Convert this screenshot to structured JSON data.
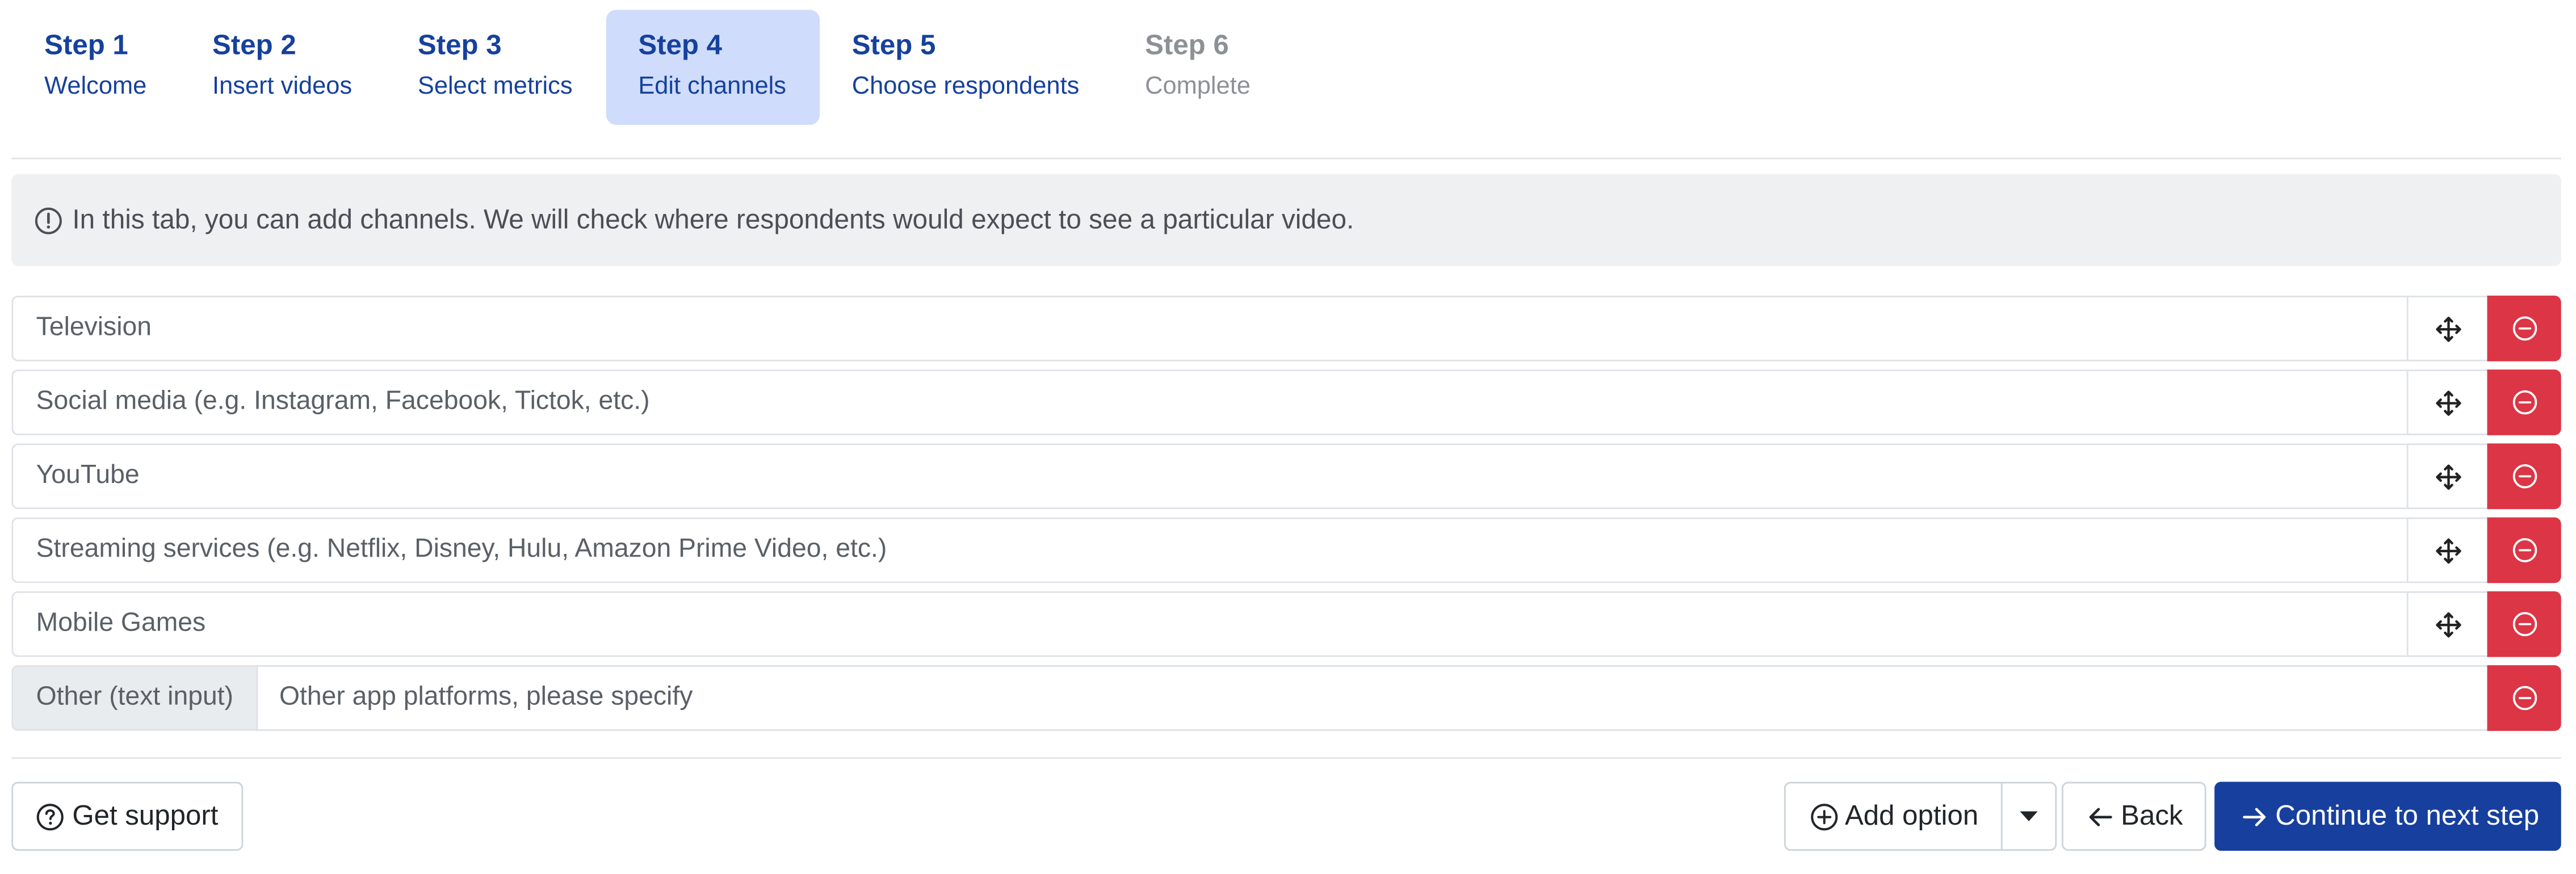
{
  "steps": [
    {
      "number": "Step 1",
      "label": "Welcome"
    },
    {
      "number": "Step 2",
      "label": "Insert videos"
    },
    {
      "number": "Step 3",
      "label": "Select metrics"
    },
    {
      "number": "Step 4",
      "label": "Edit channels"
    },
    {
      "number": "Step 5",
      "label": "Choose respondents"
    },
    {
      "number": "Step 6",
      "label": "Complete"
    }
  ],
  "active_step": "Step 4",
  "info": {
    "icon": "exclamation-circle-icon",
    "text": "In this tab, you can add channels. We will check where respondents would expect to see a particular video."
  },
  "channels": [
    {
      "value": "Television"
    },
    {
      "value": "Social media (e.g. Instagram, Facebook, Tictok, etc.)"
    },
    {
      "value": "YouTube"
    },
    {
      "value": "Streaming services (e.g. Netflix, Disney, Hulu, Amazon Prime Video, etc.)"
    },
    {
      "value": "Mobile Games"
    }
  ],
  "other_option": {
    "prefix": "Other (text input)",
    "value": "Other app platforms, please specify"
  },
  "footer": {
    "support_label": "Get support",
    "add_option_label": "Add option",
    "back_label": "Back",
    "continue_label": "Continue to next step"
  },
  "colors": {
    "primary": "#173f9d",
    "active_step_bg": "#cfdcfb",
    "danger": "#dc3545",
    "info_bg": "#eff0f2"
  }
}
